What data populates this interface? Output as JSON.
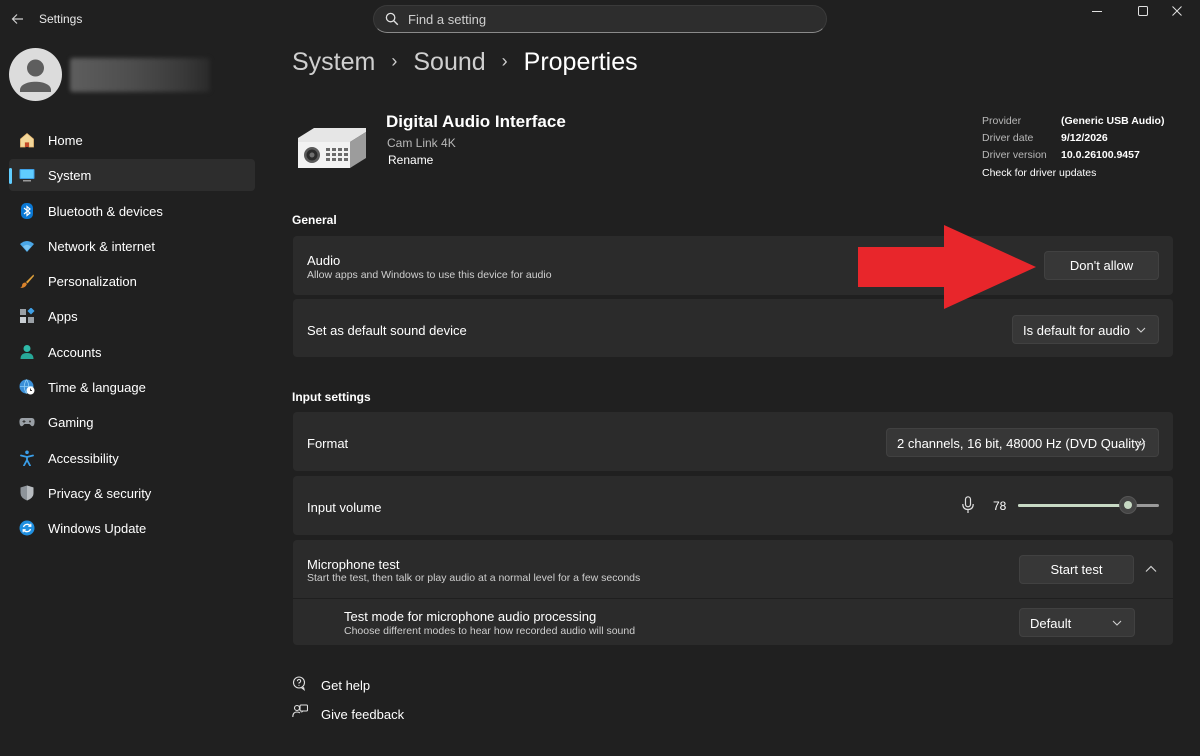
{
  "window": {
    "app_title": "Settings",
    "minimize_label": "Minimize",
    "maximize_label": "Maximize",
    "close_label": "Close"
  },
  "search": {
    "placeholder": "Find a setting",
    "value": ""
  },
  "user": {
    "avatar_icon": "person-icon"
  },
  "sidebar": {
    "items": [
      {
        "label": "Home",
        "icon": "home-icon"
      },
      {
        "label": "System",
        "icon": "system-icon",
        "active": true
      },
      {
        "label": "Bluetooth & devices",
        "icon": "bluetooth-icon"
      },
      {
        "label": "Network & internet",
        "icon": "wifi-icon"
      },
      {
        "label": "Personalization",
        "icon": "brush-icon"
      },
      {
        "label": "Apps",
        "icon": "apps-icon"
      },
      {
        "label": "Accounts",
        "icon": "accounts-icon"
      },
      {
        "label": "Time & language",
        "icon": "globe-clock-icon"
      },
      {
        "label": "Gaming",
        "icon": "gamepad-icon"
      },
      {
        "label": "Accessibility",
        "icon": "accessibility-icon"
      },
      {
        "label": "Privacy & security",
        "icon": "shield-icon"
      },
      {
        "label": "Windows Update",
        "icon": "update-icon"
      }
    ]
  },
  "breadcrumb": {
    "level1": "System",
    "level2": "Sound",
    "current": "Properties",
    "separator": "›"
  },
  "device": {
    "name": "Digital Audio Interface",
    "subtitle": "Cam Link 4K",
    "rename_label": "Rename",
    "driver": {
      "provider_key": "Provider",
      "provider_val": "(Generic USB Audio)",
      "date_key": "Driver date",
      "date_val": "9/12/2026",
      "version_key": "Driver version",
      "version_val": "10.0.26100.9457",
      "update_link": "Check for driver updates"
    }
  },
  "general": {
    "section_title": "General",
    "audio": {
      "title": "Audio",
      "description": "Allow apps and Windows to use this device for audio",
      "button_label": "Don't allow"
    },
    "default_device": {
      "title": "Set as default sound device",
      "dropdown_value": "Is default for audio"
    }
  },
  "input_settings": {
    "section_title": "Input settings",
    "format": {
      "title": "Format",
      "dropdown_value": "2 channels, 16 bit, 48000 Hz (DVD Quality)"
    },
    "input_volume": {
      "title": "Input volume",
      "value": "78",
      "level": 78
    },
    "mic_test": {
      "title": "Microphone test",
      "description": "Start the test, then talk or play audio at a normal level for a few seconds",
      "button_label": "Start test"
    },
    "test_mode": {
      "title": "Test mode for microphone audio processing",
      "description": "Choose different modes to hear how recorded audio will sound",
      "dropdown_value": "Default"
    }
  },
  "footer": {
    "help_label": "Get help",
    "feedback_label": "Give feedback"
  },
  "colors": {
    "accent": "#60cdff",
    "annotation_arrow": "#e8262b",
    "background": "#202020",
    "card": "#2b2b2b"
  }
}
